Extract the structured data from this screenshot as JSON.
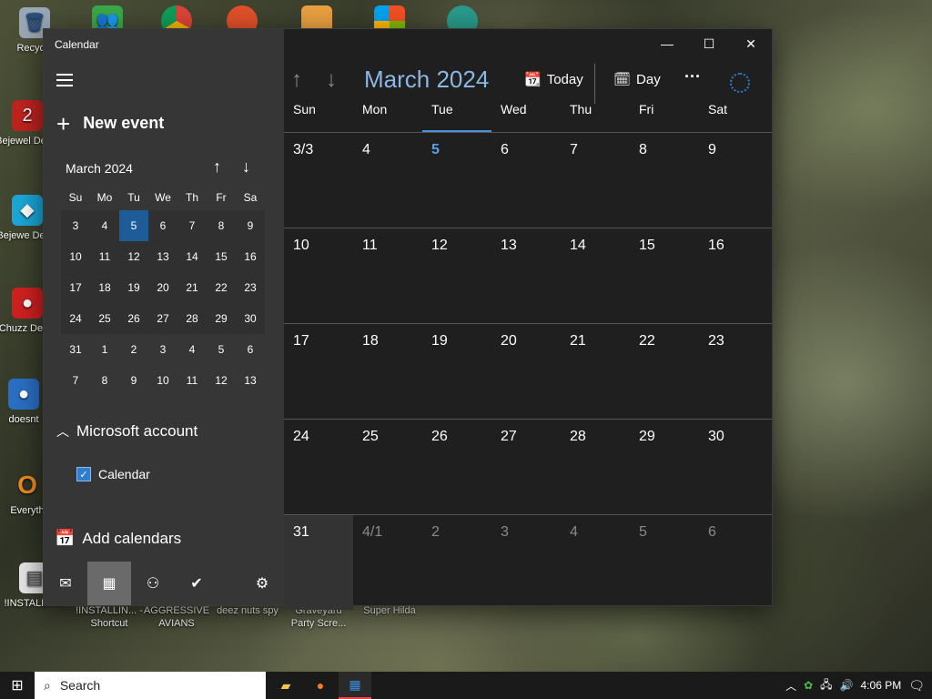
{
  "desktop": {
    "icons": [
      {
        "label": "Recycle",
        "glyph": "🗑"
      },
      {
        "label": "Bejewel Delux",
        "glyph": "2"
      },
      {
        "label": "Bejewe Delux",
        "glyph": "◆"
      },
      {
        "label": "Chuzz Delux",
        "glyph": "●"
      },
      {
        "label": "doesnt",
        "glyph": "●"
      },
      {
        "label": "Everyth",
        "glyph": "O"
      },
      {
        "label": "!INSTALLIN...",
        "glyph": "▤"
      },
      {
        "label": "!INSTALLIN... - Shortcut",
        "glyph": "▤"
      },
      {
        "label": "AGGRESSIVE AVIANS",
        "glyph": "▲"
      },
      {
        "label": "deez nuts spy",
        "glyph": "◉"
      },
      {
        "label": "Graveyard Party Scre...",
        "glyph": "✚"
      },
      {
        "label": "Super Hilda",
        "glyph": "★"
      }
    ]
  },
  "window": {
    "app_title": "Calendar",
    "controls": {
      "minimize": "—",
      "maximize": "☐",
      "close": "✕"
    }
  },
  "sidebar": {
    "new_event": "New event",
    "mini_calendar": {
      "title": "March 2024",
      "weekdays": [
        "Su",
        "Mo",
        "Tu",
        "We",
        "Th",
        "Fr",
        "Sa"
      ],
      "weeks": [
        [
          "3",
          "4",
          "5",
          "6",
          "7",
          "8",
          "9"
        ],
        [
          "10",
          "11",
          "12",
          "13",
          "14",
          "15",
          "16"
        ],
        [
          "17",
          "18",
          "19",
          "20",
          "21",
          "22",
          "23"
        ],
        [
          "24",
          "25",
          "26",
          "27",
          "28",
          "29",
          "30"
        ],
        [
          "31",
          "1",
          "2",
          "3",
          "4",
          "5",
          "6"
        ],
        [
          "7",
          "8",
          "9",
          "10",
          "11",
          "12",
          "13"
        ]
      ],
      "selected": "5"
    },
    "account": "Microsoft account",
    "calendar_item": "Calendar",
    "add_calendars": "Add calendars"
  },
  "toolbar": {
    "month_title": "March 2024",
    "today": "Today",
    "view": "Day",
    "more": "···"
  },
  "main": {
    "weekdays": [
      "Sun",
      "Mon",
      "Tue",
      "Wed",
      "Thu",
      "Fri",
      "Sat"
    ],
    "weeks": [
      [
        "3/3",
        "4",
        "5",
        "6",
        "7",
        "8",
        "9"
      ],
      [
        "10",
        "11",
        "12",
        "13",
        "14",
        "15",
        "16"
      ],
      [
        "17",
        "18",
        "19",
        "20",
        "21",
        "22",
        "23"
      ],
      [
        "24",
        "25",
        "26",
        "27",
        "28",
        "29",
        "30"
      ],
      [
        "31",
        "4/1",
        "2",
        "3",
        "4",
        "5",
        "6"
      ]
    ]
  },
  "taskbar": {
    "search_placeholder": "Search",
    "clock": "4:06 PM"
  }
}
